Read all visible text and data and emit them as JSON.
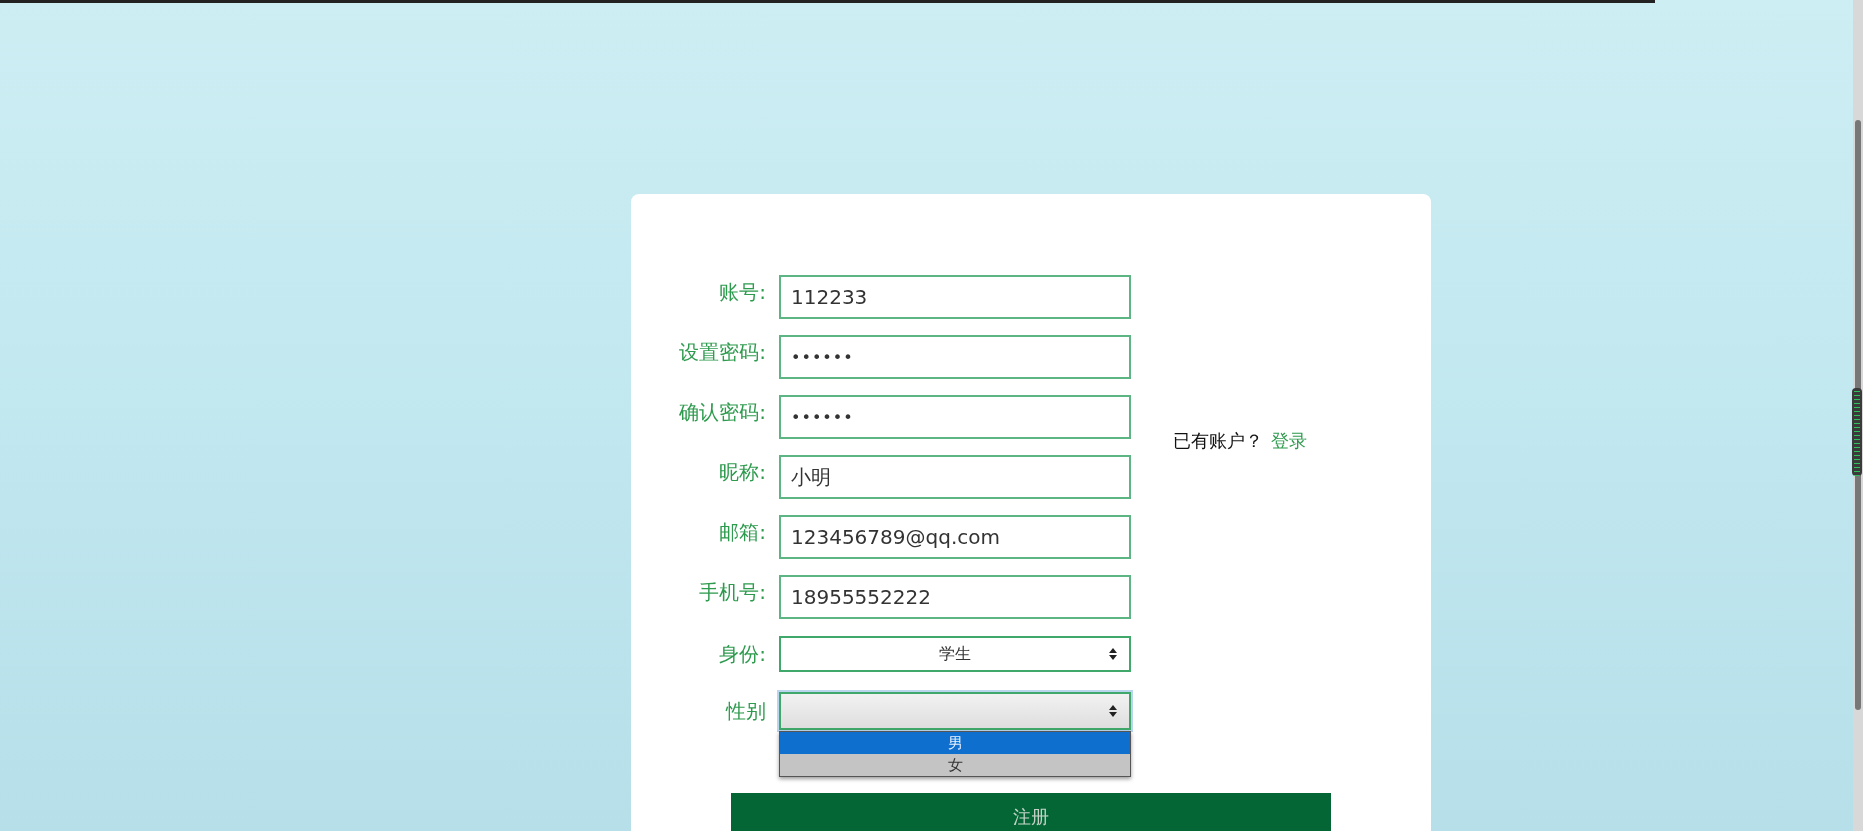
{
  "fields": [
    {
      "label": "账号:",
      "value": "112233",
      "kind": "text"
    },
    {
      "label": "设置密码:",
      "value": "••••••",
      "kind": "password"
    },
    {
      "label": "确认密码:",
      "value": "••••••",
      "kind": "password"
    },
    {
      "label": "昵称:",
      "value": "小明",
      "kind": "text"
    },
    {
      "label": "邮箱:",
      "value": "123456789@qq.com",
      "kind": "text"
    },
    {
      "label": "手机号:",
      "value": "18955552222",
      "kind": "text"
    }
  ],
  "selects": [
    {
      "label": "身份:",
      "value": "学生",
      "expanded": false
    },
    {
      "label": "性别",
      "expanded": true,
      "options": [
        {
          "label": "男",
          "selected": true
        },
        {
          "label": "女",
          "selected": false
        }
      ]
    }
  ],
  "login_prompt": {
    "text": "已有账户？",
    "link": "登录"
  },
  "submit_button": "注册"
}
